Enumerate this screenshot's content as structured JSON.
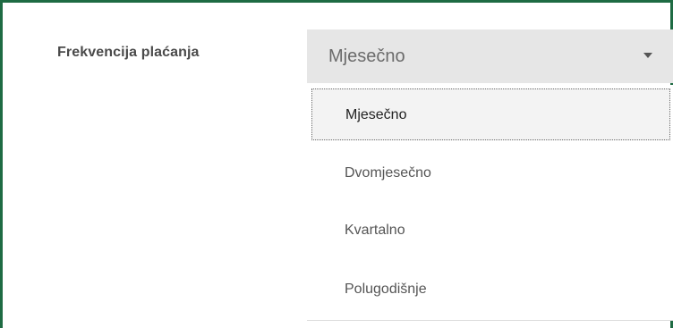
{
  "field": {
    "label": "Frekvencija plaćanja"
  },
  "select": {
    "value": "Mjesečno",
    "caret_icon": "caret-down-icon",
    "options": [
      {
        "label": "Mjesečno",
        "selected": true
      },
      {
        "label": "Dvomjesečno",
        "selected": false
      },
      {
        "label": "Kvartalno",
        "selected": false
      },
      {
        "label": "Polugodišnje",
        "selected": false
      }
    ]
  },
  "colors": {
    "frame_border": "#1e6b43",
    "select_background": "#e6e6e6"
  }
}
